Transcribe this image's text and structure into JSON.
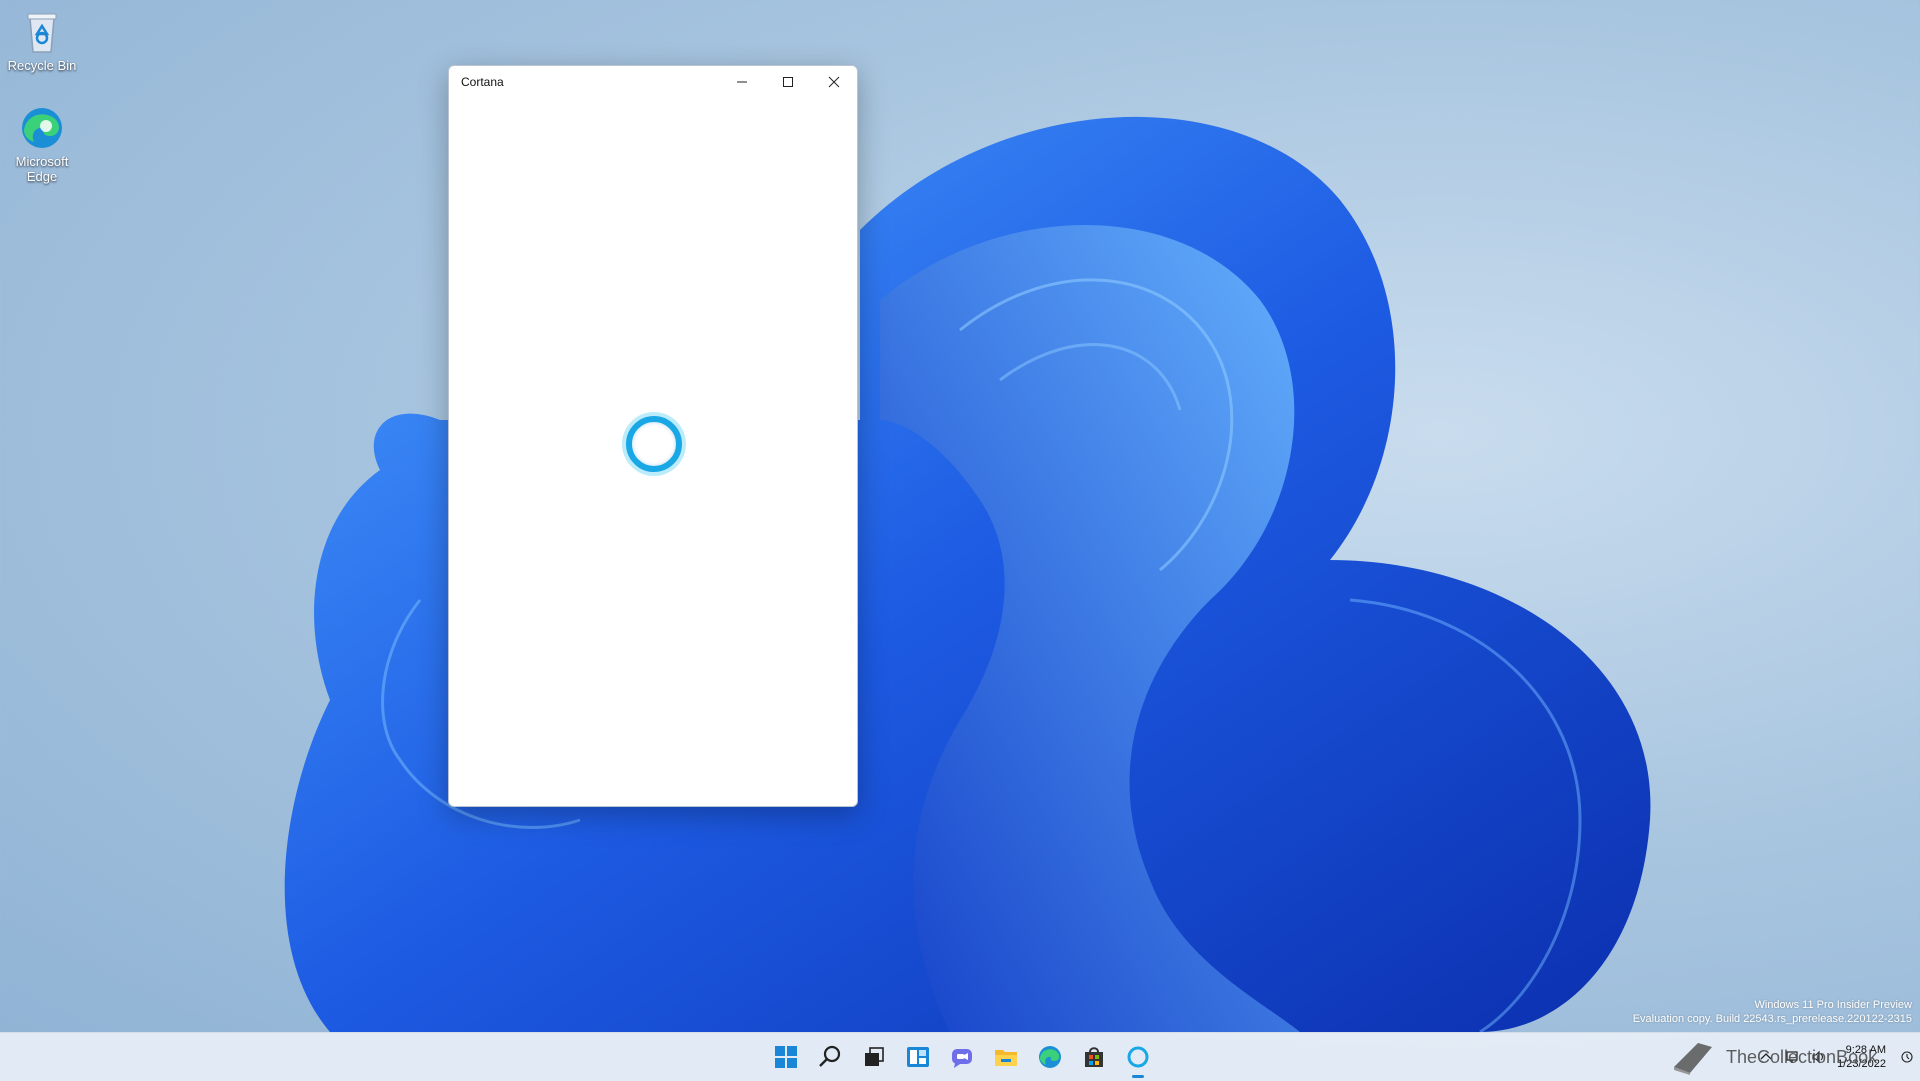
{
  "desktop": {
    "icons": [
      {
        "label": "Recycle Bin"
      },
      {
        "label": "Microsoft Edge"
      }
    ]
  },
  "window": {
    "title": "Cortana"
  },
  "watermark": {
    "line1": "Windows 11 Pro Insider Preview",
    "line2": "Evaluation copy. Build 22543.rs_prerelease.220122-2315"
  },
  "taskbar": {
    "apps": [
      "Start",
      "Search",
      "Task View",
      "Widgets",
      "Chat",
      "File Explorer",
      "Microsoft Edge",
      "Microsoft Store",
      "Cortana"
    ],
    "active_app": "Cortana"
  },
  "tray": {
    "time": "9:28 AM",
    "date": "1/23/2022",
    "brand": "TheCollectionBook"
  },
  "colors": {
    "accent": "#1aa7e6",
    "wallpaper_blue": "#1f55e0"
  }
}
